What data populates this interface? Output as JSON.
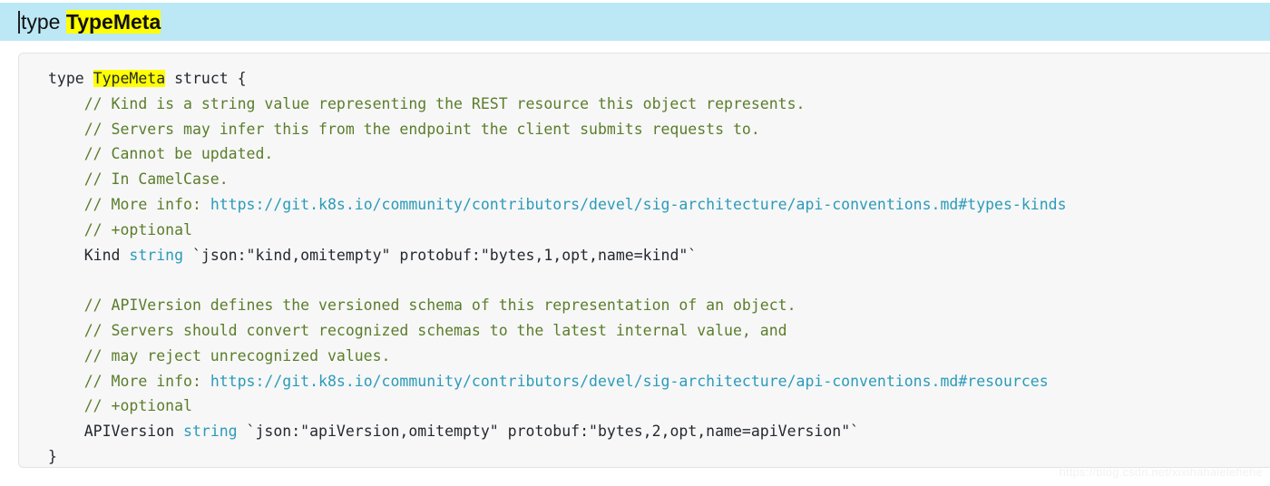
{
  "search_bar": {
    "prefix": "type ",
    "highlight": "TypeMeta",
    "full_query": "type TypeMeta",
    "caret_visible": true,
    "background_color": "#bce8f5",
    "highlight_color": "#ffff00"
  },
  "code_block": {
    "language": "go",
    "background_color": "#f7f7f8",
    "border_color": "#e3e3e5",
    "comment_color": "#5b7d2a",
    "type_color": "#2b9bb8",
    "link_color": "#2b9bb8",
    "text_color": "#24292e",
    "highlight_color": "#ffff00",
    "lines": [
      [
        {
          "t": "type ",
          "c": "tok-kw"
        },
        {
          "t": "TypeMeta",
          "c": "tok-hl"
        },
        {
          "t": " struct {",
          "c": "tok-plain"
        }
      ],
      [
        {
          "t": "    // Kind is a string value representing the REST resource this object represents.",
          "c": "tok-comment"
        }
      ],
      [
        {
          "t": "    // Servers may infer this from the endpoint the client submits requests to.",
          "c": "tok-comment"
        }
      ],
      [
        {
          "t": "    // Cannot be updated.",
          "c": "tok-comment"
        }
      ],
      [
        {
          "t": "    // In CamelCase.",
          "c": "tok-comment"
        }
      ],
      [
        {
          "t": "    // More info: ",
          "c": "tok-comment"
        },
        {
          "t": "https://git.k8s.io/community/contributors/devel/sig-architecture/api-conventions.md#types-kinds",
          "c": "tok-link"
        }
      ],
      [
        {
          "t": "    // +optional",
          "c": "tok-comment"
        }
      ],
      [
        {
          "t": "    Kind ",
          "c": "tok-plain"
        },
        {
          "t": "string",
          "c": "tok-type"
        },
        {
          "t": " `json:\"kind,omitempty\" protobuf:\"bytes,1,opt,name=kind\"`",
          "c": "tok-plain"
        }
      ],
      [
        {
          "t": "",
          "c": "tok-plain"
        }
      ],
      [
        {
          "t": "    // APIVersion defines the versioned schema of this representation of an object.",
          "c": "tok-comment"
        }
      ],
      [
        {
          "t": "    // Servers should convert recognized schemas to the latest internal value, and",
          "c": "tok-comment"
        }
      ],
      [
        {
          "t": "    // may reject unrecognized values.",
          "c": "tok-comment"
        }
      ],
      [
        {
          "t": "    // More info: ",
          "c": "tok-comment"
        },
        {
          "t": "https://git.k8s.io/community/contributors/devel/sig-architecture/api-conventions.md#resources",
          "c": "tok-link"
        }
      ],
      [
        {
          "t": "    // +optional",
          "c": "tok-comment"
        }
      ],
      [
        {
          "t": "    APIVersion ",
          "c": "tok-plain"
        },
        {
          "t": "string",
          "c": "tok-type"
        },
        {
          "t": " `json:\"apiVersion,omitempty\" protobuf:\"bytes,2,opt,name=apiVersion\"`",
          "c": "tok-plain"
        }
      ],
      [
        {
          "t": "}",
          "c": "tok-plain"
        }
      ]
    ]
  },
  "watermark": {
    "text": "https://blog.csdn.net/xixihahalelehehe"
  }
}
